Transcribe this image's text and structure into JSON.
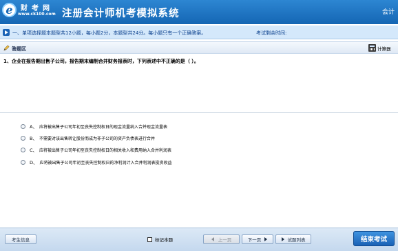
{
  "header": {
    "logo_letter": "e",
    "brand_name": "财考网",
    "brand_url": "www.ck100.com",
    "title": "注册会计师机考模拟系统",
    "subject": "会计"
  },
  "type_bar": {
    "instruction": "一、单项选择题本题型共12小题，每小题2分，本题型共24分。每小题只有一个正确答案。",
    "time_label": "考试剩余时间:"
  },
  "answer_area": {
    "label": "答题区",
    "calculator_label": "计算器"
  },
  "question": {
    "text": "1、企业在报告期出售子公司，报告期末编制合并财务报表时，下列表述中不正确的是（     ）。"
  },
  "options": [
    {
      "letter": "A、",
      "text": "应将被出售子公司年初至丧失控制权日的现金流量纳入合并现金流量表"
    },
    {
      "letter": "B、",
      "text": "不需要对该出售转让股份而成为非子公司的资产负债表进行合并"
    },
    {
      "letter": "C、",
      "text": "应将被出售子公司年初至丧失控制权日的相关收入和费用纳入合并利润表"
    },
    {
      "letter": "D、",
      "text": "应将被出售子公司年初至丧失控制权日的净利润计入合并利润表投资收益"
    }
  ],
  "footer": {
    "candidate_info": "考生信息",
    "mark_label": "标记本题",
    "prev": "上一页",
    "next": "下一页",
    "list": "试题列表",
    "end": "结束考试"
  },
  "colors": {
    "header_blue": "#1466b4",
    "type_bar_bg": "#d4e8fb",
    "end_button": "#1a61b5"
  },
  "icons": [
    "logo-icon",
    "arrow-right-icon",
    "pencil-icon",
    "calculator-icon",
    "prev-arrow-icon",
    "next-arrow-icon",
    "list-arrow-icon"
  ]
}
